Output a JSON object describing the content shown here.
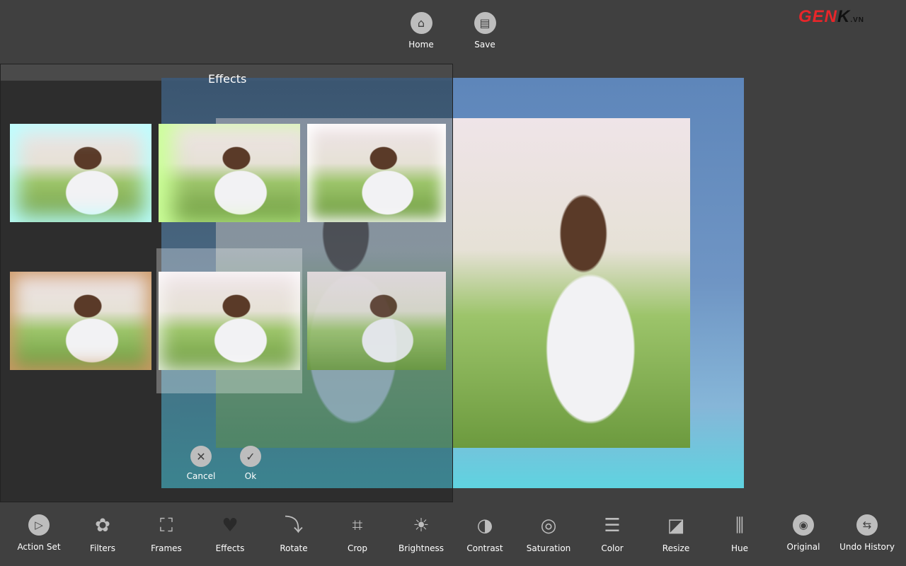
{
  "top_bar": {
    "home_label": "Home",
    "save_label": "Save"
  },
  "logo": {
    "text_red": "GEN",
    "text_dark": "K",
    "suffix": ".VN",
    "brand_color": "#e8262a"
  },
  "effects_panel": {
    "title": "Effects",
    "cancel_label": "Cancel",
    "ok_label": "Ok",
    "thumbnail_count": 6,
    "selected_index": 4
  },
  "toolbar": {
    "items": [
      {
        "label": "Action Set",
        "icon": "play-icon"
      },
      {
        "label": "Filters",
        "icon": "flower-icon"
      },
      {
        "label": "Frames",
        "icon": "frame-star-icon"
      },
      {
        "label": "Effects",
        "icon": "heart-icon"
      },
      {
        "label": "Rotate",
        "icon": "rotate-icon"
      },
      {
        "label": "Crop",
        "icon": "crop-icon"
      },
      {
        "label": "Brightness",
        "icon": "sun-icon"
      },
      {
        "label": "Contrast",
        "icon": "contrast-icon"
      },
      {
        "label": "Saturation",
        "icon": "spiral-icon"
      },
      {
        "label": "Color",
        "icon": "sliders-icon"
      },
      {
        "label": "Resize",
        "icon": "resize-icon"
      },
      {
        "label": "Hue",
        "icon": "hue-icon"
      },
      {
        "label": "Original",
        "icon": "eye-icon"
      },
      {
        "label": "Undo History",
        "icon": "undo-history-icon"
      }
    ]
  }
}
